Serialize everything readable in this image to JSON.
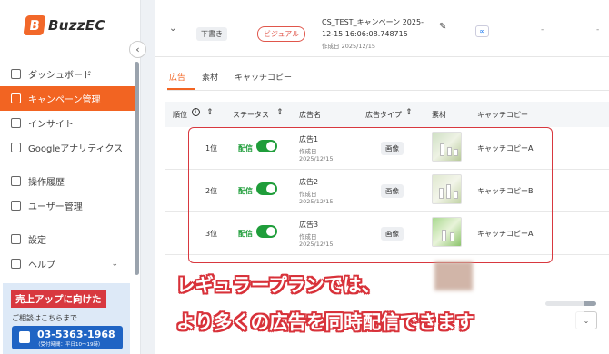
{
  "brand": {
    "logo_mark": "B",
    "name": "BuzzEC"
  },
  "sidebar": {
    "items": [
      {
        "label": "ダッシュボード",
        "icon": "home-icon"
      },
      {
        "label": "キャンペーン管理",
        "icon": "megaphone-icon",
        "active": true
      },
      {
        "label": "インサイト",
        "icon": "chart-line-icon"
      },
      {
        "label": "Googleアナリティクス",
        "icon": "bar-chart-icon"
      },
      {
        "label": "操作履歴",
        "icon": "history-icon"
      },
      {
        "label": "ユーザー管理",
        "icon": "users-icon"
      },
      {
        "label": "設定",
        "icon": "gear-icon"
      },
      {
        "label": "ヘルプ",
        "icon": "help-icon"
      }
    ],
    "collapse_glyph": "‹",
    "help_chevron": "⌄"
  },
  "promo": {
    "title": "売上アップに向けた",
    "subtitle": "ご相談はこちらまで",
    "phone": "03-5363-1968",
    "hours": "（受付時間：平日10〜19時）"
  },
  "campaign": {
    "status": "下書き",
    "type": "ビジュアル",
    "name": "CS_TEST_キャンペーン 2025-12-15 16:06:08.748715",
    "created_label": "作成日",
    "created": "2025/12/15",
    "dash": "-"
  },
  "tabs": [
    {
      "label": "広告",
      "active": true
    },
    {
      "label": "素材"
    },
    {
      "label": "キャッチコピー"
    }
  ],
  "table": {
    "headers": {
      "rank": "順位",
      "status": "ステータス",
      "name": "広告名",
      "type": "広告タイプ",
      "material": "素材",
      "copy": "キャッチコピー"
    },
    "rows": [
      {
        "rank": "1位",
        "status": "配信",
        "on": true,
        "name": "広告1",
        "created_label": "作成日",
        "created": "2025/12/15",
        "type": "画像",
        "copy": "キャッチコピーA"
      },
      {
        "rank": "2位",
        "status": "配信",
        "on": true,
        "name": "広告2",
        "created_label": "作成日",
        "created": "2025/12/15",
        "type": "画像",
        "copy": "キャッチコピーB"
      },
      {
        "rank": "3位",
        "status": "配信",
        "on": true,
        "name": "広告3",
        "created_label": "作成日",
        "created": "2025/12/15",
        "type": "画像",
        "copy": "キャッチコピーA"
      }
    ]
  },
  "caption": {
    "line1": "レギュラープランでは、",
    "line2": "より多くの広告を同時配信できます"
  },
  "colors": {
    "accent": "#f26422",
    "caption_outline": "#d8323a",
    "toggle_on": "#1f9d3a"
  }
}
